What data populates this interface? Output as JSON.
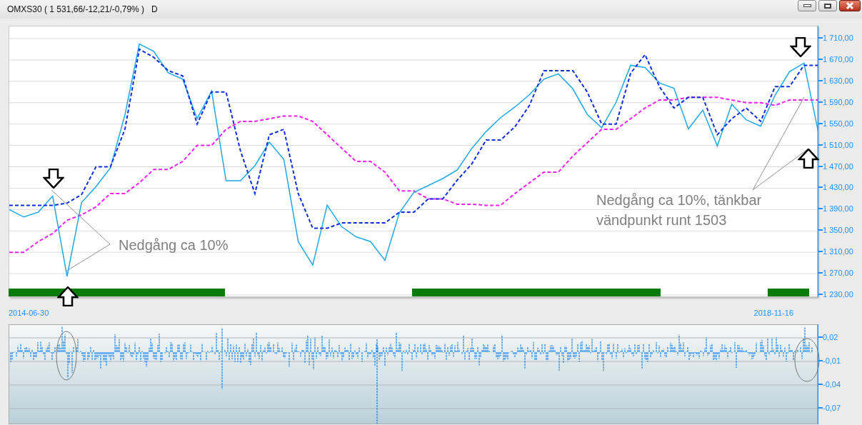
{
  "window": {
    "title": "OMXS30 ( 1 531,66/-12,21/-0,79% )",
    "period": "D"
  },
  "price_panel": {
    "chart_data": {
      "type": "line",
      "grid": true,
      "ylim": [
        1224.7,
        1732.7
      ],
      "yticks": [
        {
          "value": 1710,
          "label": "1 710,00"
        },
        {
          "value": 1670,
          "label": "1 670,00"
        },
        {
          "value": 1630,
          "label": "1 630,00"
        },
        {
          "value": 1590,
          "label": "1 590,00"
        },
        {
          "value": 1550,
          "label": "1 550,00"
        },
        {
          "value": 1510,
          "label": "1 510,00"
        },
        {
          "value": 1470,
          "label": "1 470,00"
        },
        {
          "value": 1430,
          "label": "1 430,00"
        },
        {
          "value": 1390,
          "label": "1 390,00"
        },
        {
          "value": 1350,
          "label": "1 350,00"
        },
        {
          "value": 1310,
          "label": "1 310,00"
        },
        {
          "value": 1270,
          "label": "1 270,00"
        },
        {
          "value": 1230,
          "label": "1 230,00"
        }
      ],
      "series": [
        {
          "color": "#1ea8e6",
          "values": [
            1390,
            1376,
            1385,
            1415,
            1265,
            1403,
            1433,
            1468,
            1567,
            1700,
            1686,
            1646,
            1634,
            1560,
            1612,
            1444,
            1444,
            1472,
            1516,
            1484,
            1330,
            1286,
            1398,
            1358,
            1339,
            1330,
            1295,
            1384,
            1422,
            1435,
            1448,
            1464,
            1504,
            1536,
            1562,
            1582,
            1605,
            1634,
            1644,
            1616,
            1568,
            1543,
            1591,
            1660,
            1656,
            1627,
            1617,
            1541,
            1576,
            1509,
            1587,
            1558,
            1546,
            1604,
            1648,
            1664,
            1534
          ]
        },
        {
          "color": "#1030e0",
          "line_style": "dashed",
          "values": [
            1398,
            1398,
            1398,
            1398,
            1402,
            1418,
            1470,
            1470,
            1540,
            1690,
            1675,
            1650,
            1640,
            1550,
            1610,
            1610,
            1500,
            1420,
            1530,
            1540,
            1420,
            1355,
            1355,
            1365,
            1365,
            1365,
            1365,
            1385,
            1385,
            1410,
            1410,
            1445,
            1475,
            1520,
            1520,
            1545,
            1585,
            1650,
            1650,
            1650,
            1610,
            1550,
            1550,
            1645,
            1680,
            1620,
            1580,
            1600,
            1600,
            1530,
            1560,
            1580,
            1555,
            1620,
            1620,
            1660,
            1660
          ]
        },
        {
          "color": "#f020f0",
          "line_style": "dashed",
          "values": [
            1310,
            1310,
            1330,
            1345,
            1370,
            1380,
            1395,
            1420,
            1420,
            1440,
            1465,
            1465,
            1480,
            1510,
            1510,
            1540,
            1555,
            1555,
            1560,
            1565,
            1565,
            1555,
            1530,
            1505,
            1480,
            1480,
            1460,
            1425,
            1425,
            1410,
            1410,
            1400,
            1400,
            1398,
            1398,
            1420,
            1440,
            1460,
            1460,
            1490,
            1515,
            1540,
            1540,
            1560,
            1580,
            1595,
            1595,
            1600,
            1600,
            1600,
            1595,
            1590,
            1590,
            1585,
            1595,
            1595,
            1595
          ]
        }
      ]
    },
    "annotations": [
      {
        "text": "Nedgång ca 10%"
      },
      {
        "text": "Nedgång ca 10%, tänkbar vändpunkt runt 1503"
      }
    ]
  },
  "date_range": {
    "start": "2014-06-30",
    "end": "2018-11-16"
  },
  "lower_panel": {
    "yticks": [
      "0,02",
      "-0,01",
      "-0,04",
      "-0,07"
    ]
  }
}
